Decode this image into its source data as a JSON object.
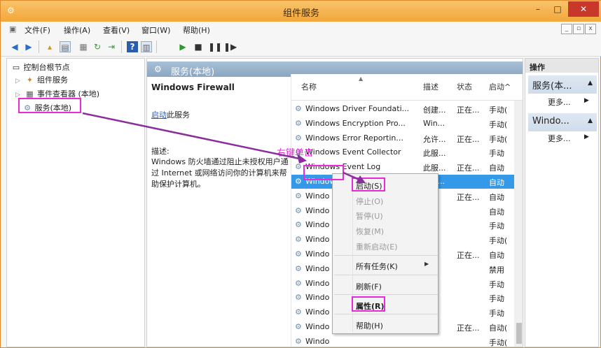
{
  "window": {
    "title": "组件服务",
    "minimize": "–",
    "maximize": "□",
    "close": "✕"
  },
  "menu": {
    "items": [
      "文件(F)",
      "操作(A)",
      "查看(V)",
      "窗口(W)",
      "帮助(H)"
    ]
  },
  "mdi": {
    "minimize": "_",
    "restore": "▫",
    "close": "x"
  },
  "tree": {
    "root": "控制台根节点",
    "items": [
      {
        "label": "组件服务",
        "icon": "component-icon"
      },
      {
        "label": "事件查看器 (本地)",
        "icon": "event-viewer-icon"
      },
      {
        "label": "服务(本地)",
        "icon": "services-icon"
      }
    ]
  },
  "center": {
    "header": "服务(本地)",
    "service_name": "Windows Firewall",
    "start_link": "启动",
    "start_suffix": "此服务",
    "desc_label": "描述:",
    "desc_text": "Windows 防火墙通过阻止未授权用户通过 Internet 或网络访问你的计算机来帮助保护计算机。"
  },
  "list": {
    "columns": [
      "名称",
      "描述",
      "状态",
      "启动^"
    ],
    "rows": [
      {
        "name": "Windows Driver Foundati...",
        "desc": "创建...",
        "status": "正在...",
        "startup": "手动("
      },
      {
        "name": "Windows Encryption Pro...",
        "desc": "Win...",
        "status": "",
        "startup": "手动("
      },
      {
        "name": "Windows Error Reportin...",
        "desc": "允许...",
        "status": "正在...",
        "startup": "手动("
      },
      {
        "name": "Windows Event Collector",
        "desc": "此服...",
        "status": "",
        "startup": "手动"
      },
      {
        "name": "Windows Event Log",
        "desc": "此服...",
        "status": "正在...",
        "startup": "自动"
      },
      {
        "name": "Windows Firewall",
        "desc": "Win...",
        "status": "",
        "startup": "自动"
      },
      {
        "name": "Windo",
        "desc": "",
        "status": "正在...",
        "startup": "自动"
      },
      {
        "name": "Windo",
        "desc": "",
        "status": "",
        "startup": "自动"
      },
      {
        "name": "Windo",
        "desc": "",
        "status": "",
        "startup": "手动"
      },
      {
        "name": "Windo",
        "desc": "",
        "status": "",
        "startup": "手动("
      },
      {
        "name": "Windo",
        "desc": "",
        "status": "正在...",
        "startup": "自动"
      },
      {
        "name": "Windo",
        "desc": "",
        "status": "",
        "startup": "禁用"
      },
      {
        "name": "Windo",
        "desc": "",
        "status": "",
        "startup": "手动"
      },
      {
        "name": "Windo",
        "desc": "",
        "status": "",
        "startup": "手动"
      },
      {
        "name": "Windo",
        "desc": "",
        "status": "",
        "startup": "手动"
      },
      {
        "name": "Windo",
        "desc": "",
        "status": "正在...",
        "startup": "自动("
      },
      {
        "name": "Windo",
        "desc": "",
        "status": "",
        "startup": "手动("
      },
      {
        "name": "Windows Time",
        "desc": "维护...",
        "status": "",
        "startup": "手动("
      }
    ]
  },
  "context_menu": {
    "start": "启动(S)",
    "stop": "停止(O)",
    "pause": "暂停(U)",
    "resume": "恢复(M)",
    "restart": "重新启动(E)",
    "all_tasks": "所有任务(K)",
    "refresh": "刷新(F)",
    "properties": "属性(R)",
    "help": "帮助(H)"
  },
  "actions": {
    "header": "操作",
    "section1": "服务(本...",
    "more1": "更多...",
    "section2": "Windo...",
    "more2": "更多..."
  },
  "annotation": {
    "text": "右键单击",
    "color": "#e82ad8"
  },
  "colors": {
    "titlebar": "#f2a73a",
    "selection": "#3399e8",
    "highlight": "#e82ad8",
    "arrow": "#8a2e9e"
  }
}
